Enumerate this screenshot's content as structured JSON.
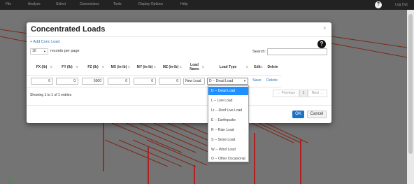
{
  "navbar": {
    "items": [
      "File",
      "Analyze",
      "Select",
      "Connections",
      "Tools",
      "Display Options",
      "Help"
    ],
    "help_icon": "?",
    "logout_label": "Log Out"
  },
  "modal": {
    "title": "Concentrated Loads",
    "close_icon": "×",
    "add_link": "+ Add Conc Load",
    "page_length": "10",
    "page_length_suffix": "records per page",
    "info_icon": "?",
    "search_label": "Search:",
    "search_value": "",
    "columns": [
      "FX (lb)",
      "FY (lb)",
      "FZ (lb)",
      "MX (in-lb)",
      "MY (in-lb)",
      "MZ (in-lb)",
      "Load Name",
      "Load Type",
      "Edit",
      "Delete"
    ],
    "row": {
      "fx": "0",
      "fy": "0",
      "fz": "5000",
      "mx": "0",
      "my": "0",
      "mz": "0",
      "name": "New Load",
      "type": "D -- Dead Load",
      "edit": "Save",
      "delete": "Delete"
    },
    "entries_text": "Showing 1 to 1 of 1 entries",
    "pager": {
      "previous": "← Previous",
      "page": "1",
      "next": "Next →"
    },
    "ok_label": "OK",
    "cancel_label": "Cancel"
  },
  "load_type_options": [
    "D -- Dead Load",
    "L -- Live Load",
    "Lr -- Roof Live Load",
    "E -- Earthquake",
    "R -- Rain Load",
    "S -- Snow Load",
    "W -- Wind Load",
    "O -- Other Occasional"
  ],
  "selected_option_index": 0,
  "colors": {
    "accent": "#1a73c4",
    "link": "#2a6fb8",
    "option_highlight": "#1e90ff"
  }
}
